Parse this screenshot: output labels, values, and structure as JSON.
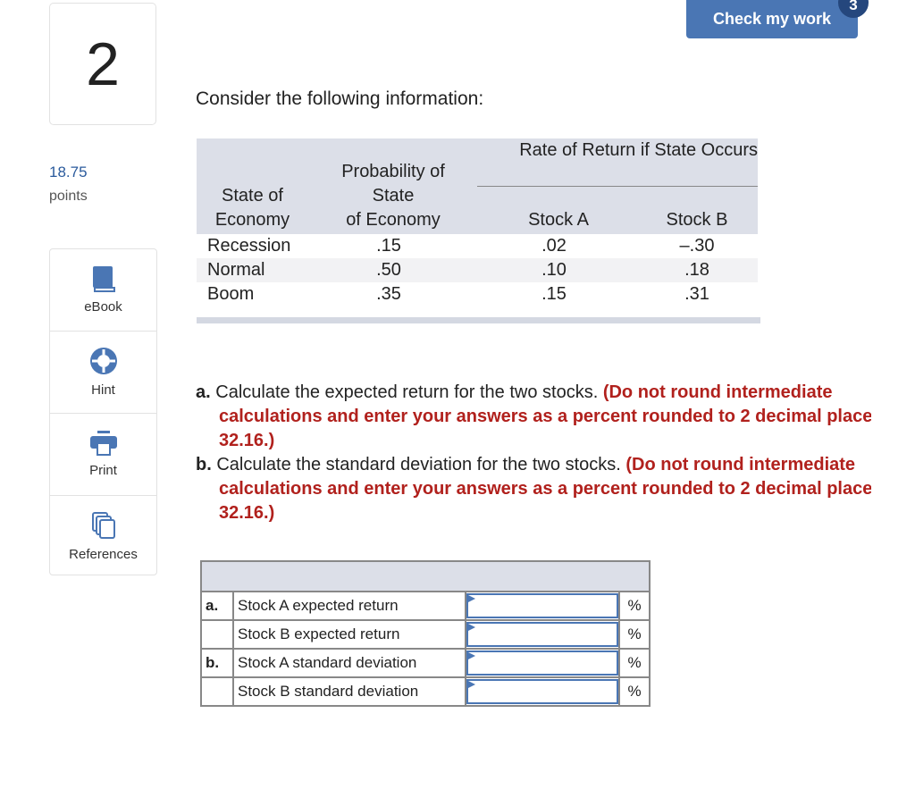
{
  "question": {
    "number": "2",
    "points": "18.75",
    "points_label": "points"
  },
  "tools": [
    {
      "label": "eBook",
      "icon": "book-icon"
    },
    {
      "label": "Hint",
      "icon": "lifebuoy-icon"
    },
    {
      "label": "Print",
      "icon": "printer-icon"
    },
    {
      "label": "References",
      "icon": "documents-icon"
    }
  ],
  "header": {
    "check_label": "Check my work",
    "badge": "3"
  },
  "intro": "Consider the following information:",
  "info_table": {
    "group_header": "Rate of Return if State Occurs",
    "col1": [
      "State of",
      "Economy"
    ],
    "col2": [
      "Probability of",
      "State",
      "of Economy"
    ],
    "col3": "Stock A",
    "col4": "Stock B",
    "rows": [
      {
        "state": "Recession",
        "prob": ".15",
        "a": ".02",
        "b": "–.30"
      },
      {
        "state": "Normal",
        "prob": ".50",
        "a": ".10",
        "b": ".18"
      },
      {
        "state": "Boom",
        "prob": ".35",
        "a": ".15",
        "b": ".31"
      }
    ]
  },
  "instructions": {
    "a_label": "a.",
    "a_text": "Calculate the expected return for the two stocks.",
    "a_red1": "(Do not round intermediate",
    "a_red2": "calculations and enter your answers as a percent rounded to 2 decimal places, e.g.,",
    "a_red3": "32.16.)",
    "b_label": "b.",
    "b_text": "Calculate the standard deviation for the two stocks.",
    "b_red1": "(Do not round intermediate",
    "b_red2": "calculations and enter your answers as a percent rounded to 2 decimal places, e.g.,",
    "b_red3": "32.16.)"
  },
  "answers": [
    {
      "part": "a.",
      "label": "Stock A expected return",
      "value": "",
      "unit": "%"
    },
    {
      "part": "",
      "label": "Stock B expected return",
      "value": "",
      "unit": "%"
    },
    {
      "part": "b.",
      "label": "Stock A standard deviation",
      "value": "",
      "unit": "%"
    },
    {
      "part": "",
      "label": "Stock B standard deviation",
      "value": "",
      "unit": "%"
    }
  ],
  "colors": {
    "accent": "#4a76b4",
    "badge": "#25477d",
    "emphasis": "#b1211d",
    "table_header": "#dcdfe8"
  }
}
